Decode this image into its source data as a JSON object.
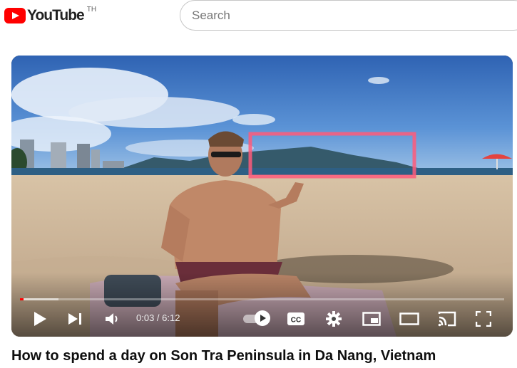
{
  "header": {
    "logo_text": "YouTube",
    "country_code": "TH",
    "search_placeholder": "Search"
  },
  "player": {
    "current_time": "0:03",
    "separator": " / ",
    "duration": "6:12",
    "progress_fraction": 0.008,
    "buffered_fraction": 0.08,
    "autoplay_on": true,
    "controls": [
      "play-icon",
      "next-icon",
      "volume-icon",
      "autoplay-toggle",
      "captions-icon",
      "settings-icon",
      "miniplayer-icon",
      "theater-mode-icon",
      "cast-icon",
      "fullscreen-icon"
    ],
    "captions_label": "CC",
    "scene_colors": {
      "sky": "#3f78c4",
      "sand": "#cdb59a",
      "sea": "#2e5f84",
      "highlight_box": "#ff5a7a"
    }
  },
  "video": {
    "title": "How to spend a day on Son Tra Peninsula in Da Nang, Vietnam"
  },
  "colors": {
    "brand": "#ff0000",
    "progress": "#ff0000"
  }
}
